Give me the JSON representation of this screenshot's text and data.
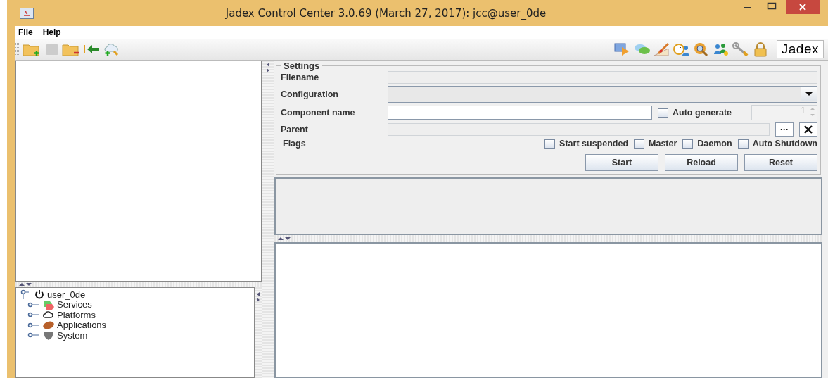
{
  "window": {
    "title": "Jadex Control Center 3.0.69 (March 27, 2017): jcc@user_0de"
  },
  "menu": [
    "File",
    "Help"
  ],
  "toolbar": {
    "logo": "Jadex"
  },
  "tree": {
    "label": "user_0de",
    "expanded": true,
    "children": [
      {
        "label": "Services",
        "kind": "services",
        "expanded": false
      },
      {
        "label": "Platforms",
        "kind": "platforms",
        "expanded": false
      },
      {
        "label": "Applications",
        "kind": "applications",
        "expanded": false
      },
      {
        "label": "System",
        "kind": "system",
        "expanded": false
      }
    ]
  },
  "settings": {
    "title": "Settings",
    "filename": {
      "label": "Filename"
    },
    "configuration": {
      "label": "Configuration"
    },
    "component_name": {
      "label": "Component name",
      "auto_generate": {
        "label": "Auto generate",
        "checked": false
      },
      "count": "1"
    },
    "parent": {
      "label": "Parent",
      "browse": "···"
    },
    "flags": {
      "label": "Flags",
      "items": [
        {
          "label": "Start suspended",
          "checked": false
        },
        {
          "label": "Master",
          "checked": false
        },
        {
          "label": "Daemon",
          "checked": false
        },
        {
          "label": "Auto Shutdown",
          "checked": false
        }
      ]
    },
    "buttons": [
      "Start",
      "Reload",
      "Reset"
    ]
  }
}
